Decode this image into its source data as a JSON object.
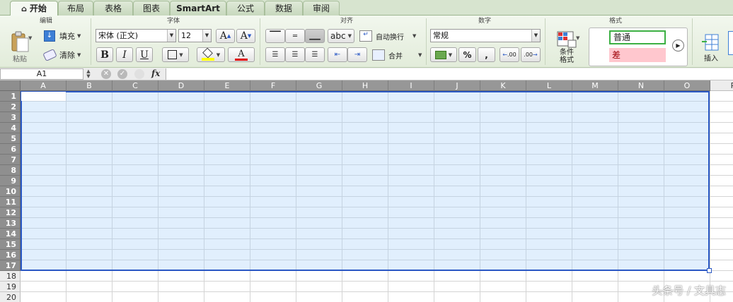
{
  "tabs": [
    {
      "label": "开始",
      "active": true
    },
    {
      "label": "布局"
    },
    {
      "label": "表格"
    },
    {
      "label": "图表"
    },
    {
      "label": "SmartArt"
    },
    {
      "label": "公式"
    },
    {
      "label": "数据"
    },
    {
      "label": "审阅"
    }
  ],
  "ribbon": {
    "edit": {
      "title": "编辑",
      "paste": "粘贴",
      "fill": "填充",
      "clear": "清除"
    },
    "font": {
      "title": "字体",
      "name": "宋体 (正文)",
      "size": "12",
      "bold": "B",
      "italic": "I",
      "underline": "U",
      "grow": "A",
      "shrink": "A",
      "font_color": "A",
      "fill_color": "#ffff00",
      "text_color": "#e00000"
    },
    "align": {
      "title": "对齐",
      "orientation": "abc",
      "wrap": "自动换行",
      "merge": "合并"
    },
    "number": {
      "title": "数字",
      "format": "常规",
      "percent": "%",
      "comma": ",",
      "inc_decimal": ".00",
      "dec_decimal": ".00"
    },
    "format": {
      "title": "格式",
      "conditional": "条件格式",
      "style_normal": "普通",
      "style_bad": "差",
      "insert": "插入"
    }
  },
  "formula_bar": {
    "name_box": "A1",
    "fx": "fx",
    "value": ""
  },
  "columns": [
    "A",
    "B",
    "C",
    "D",
    "E",
    "F",
    "G",
    "H",
    "I",
    "J",
    "K",
    "L",
    "M",
    "N",
    "O",
    "P"
  ],
  "rows": [
    "1",
    "2",
    "3",
    "4",
    "5",
    "6",
    "7",
    "8",
    "9",
    "10",
    "11",
    "12",
    "13",
    "14",
    "15",
    "16",
    "17",
    "18",
    "19",
    "20"
  ],
  "selection": {
    "range": "A1:O17",
    "color": "#2a58c4"
  },
  "watermark": "头条号 / 文具志"
}
